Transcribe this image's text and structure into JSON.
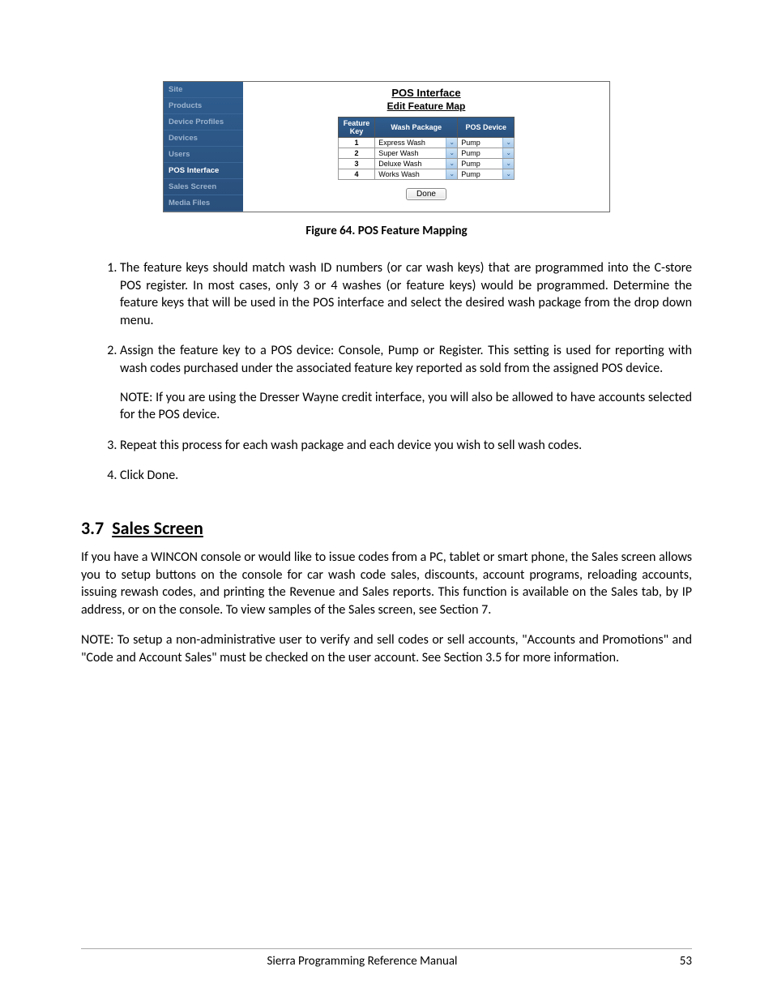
{
  "screenshot": {
    "sidenav": {
      "items": [
        {
          "label": "Site",
          "selected": false
        },
        {
          "label": "Products",
          "selected": false
        },
        {
          "label": "Device Profiles",
          "selected": false
        },
        {
          "label": "Devices",
          "selected": false
        },
        {
          "label": "Users",
          "selected": false
        },
        {
          "label": "POS Interface",
          "selected": true
        },
        {
          "label": "Sales Screen",
          "selected": false
        },
        {
          "label": "Media Files",
          "selected": false
        }
      ]
    },
    "main": {
      "title": "POS Interface",
      "subtitle": "Edit Feature Map",
      "cols": {
        "key": "Feature Key",
        "wash": "Wash Package",
        "device": "POS Device"
      },
      "rows": [
        {
          "key": "1",
          "wash": "Express Wash",
          "device": "Pump"
        },
        {
          "key": "2",
          "wash": "Super Wash",
          "device": "Pump"
        },
        {
          "key": "3",
          "wash": "Deluxe Wash",
          "device": "Pump"
        },
        {
          "key": "4",
          "wash": "Works Wash",
          "device": "Pump"
        }
      ],
      "done": "Done"
    }
  },
  "caption": "Figure 64. POS Feature Mapping",
  "steps": [
    {
      "text": "The feature keys should match wash ID numbers (or car wash keys) that are programmed into the C-store POS register. In most cases, only 3 or 4 washes (or feature keys) would be programmed. Determine the feature keys that will be used in the POS interface and select the desired wash package from the drop down menu."
    },
    {
      "text": "Assign the feature key to a POS device: Console, Pump or Register. This setting is used for reporting with wash codes purchased under the associated feature key reported as sold from the assigned POS device.",
      "note": "NOTE: If you are using the Dresser Wayne credit interface, you will also be allowed to have accounts selected for the POS device."
    },
    {
      "text": "Repeat this process for each wash package and each device you wish to sell wash codes."
    },
    {
      "text": "Click Done."
    }
  ],
  "section": {
    "number": "3.7",
    "title": "Sales Screen",
    "p1": "If you have a WINCON console or would like to issue codes from a PC, tablet or smart phone, the Sales screen allows you to setup buttons on the console for car wash code sales, discounts, account programs, reloading accounts, issuing rewash codes, and printing the Revenue and Sales reports. This function is available on the Sales tab, by IP address, or on the console. To view samples of the Sales screen, see Section 7.",
    "p2": "NOTE: To setup a non-administrative user to verify and sell codes or sell accounts, \"Accounts and Promotions\" and \"Code and Account Sales\" must be checked on the user account. See Section 3.5 for more information."
  },
  "footer": {
    "center": "Sierra Programming Reference Manual",
    "page": "53"
  }
}
